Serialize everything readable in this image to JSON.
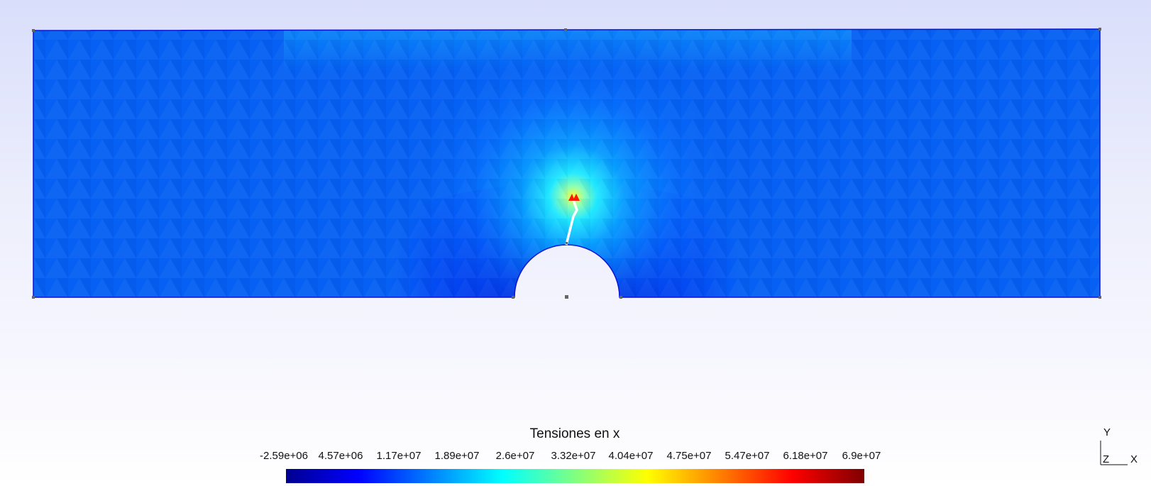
{
  "legend": {
    "title": "Tensiones en x",
    "labels": [
      "-2.59e+06",
      "4.57e+06",
      "1.17e+07",
      "1.89e+07",
      "2.6e+07",
      "3.32e+07",
      "4.04e+07",
      "4.75e+07",
      "5.47e+07",
      "6.18e+07",
      "6.9e+07"
    ]
  },
  "axes": {
    "y": "Y",
    "z": "Z",
    "x": "X"
  },
  "colors": {
    "body": "#0560f3",
    "edge": "#0a14d8",
    "crack": "#ffffff",
    "hot": "#ff1a00"
  }
}
